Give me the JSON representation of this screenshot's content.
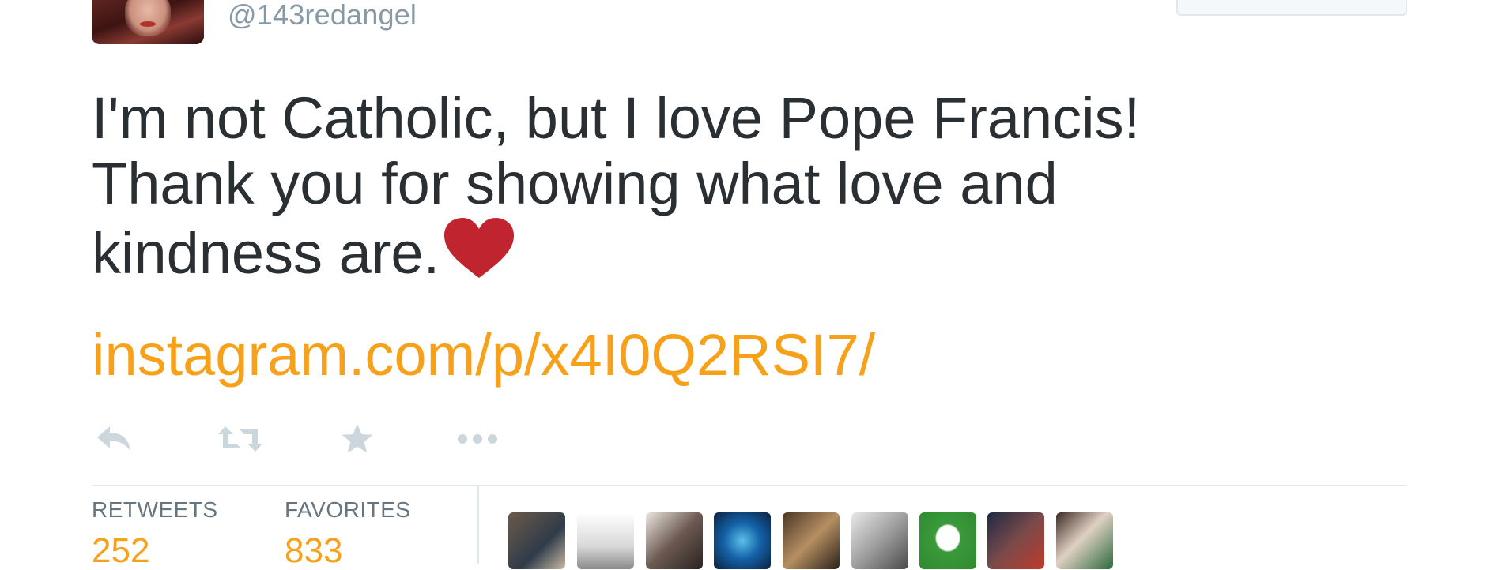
{
  "user": {
    "handle": "@143redangel",
    "avatar_icon": "profile-photo"
  },
  "follow_button": {
    "label": ""
  },
  "tweet": {
    "lines": [
      "I'm not Catholic, but I love Pope Francis!",
      "Thank you for showing what love and",
      "kindness are."
    ],
    "emoji_icon": "red-heart-emoji",
    "link": "instagram.com/p/x4I0Q2RSI7/",
    "link_color": "#f7a11b",
    "text_color": "#292f33"
  },
  "actions": [
    {
      "name": "reply",
      "icon": "reply-icon"
    },
    {
      "name": "retweet",
      "icon": "retweet-icon"
    },
    {
      "name": "favorite",
      "icon": "star-icon"
    },
    {
      "name": "more",
      "icon": "more-icon"
    }
  ],
  "stats": {
    "retweets_label": "RETWEETS",
    "retweets_value": "252",
    "favorites_label": "FAVORITES",
    "favorites_value": "833"
  },
  "favoriters_count_shown": 9,
  "colors": {
    "accent": "#f7a11b",
    "muted": "#8899a6",
    "divider": "#e1e8ed",
    "heart": "#c0252f"
  }
}
